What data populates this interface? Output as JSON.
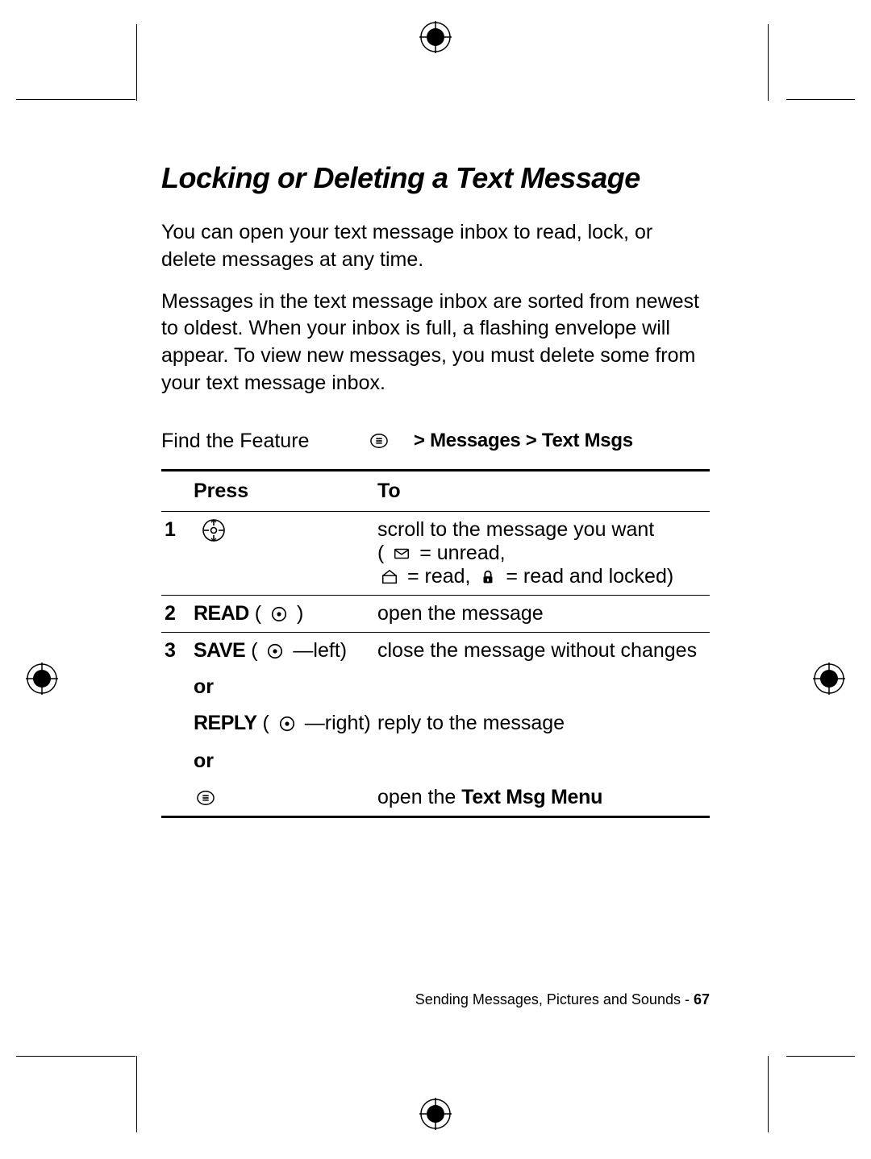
{
  "title": "Locking or Deleting a Text Message",
  "para1": "You can open your text message inbox to read, lock, or delete messages at any time.",
  "para2": "Messages in the text message inbox are sorted from newest to oldest. When your inbox is full, a flashing envelope will appear. To view new messages, you must delete some from your text message inbox.",
  "findFeatureLabel": "Find the Feature",
  "navPath": "> Messages > Text Msgs",
  "headers": {
    "press": "Press",
    "to": "To"
  },
  "steps": {
    "s1": {
      "num": "1",
      "to_pre": "scroll to the message you want",
      "to_leg_open": "(",
      "to_leg_unread": " = unread,",
      "to_leg_read": " = read, ",
      "to_leg_locked": " = read and locked)"
    },
    "s2": {
      "num": "2",
      "pressLabel": "READ",
      "pressSuffix": ")",
      "to": "open the message"
    },
    "s3": {
      "num": "3",
      "press1Label": "SAVE",
      "press1Suffix": "—left)",
      "to1": "close the message without changes",
      "or1": "or",
      "press2Label": "REPLY",
      "press2Suffix": "—right)",
      "to2": "reply to the message",
      "or2": "or",
      "to3_pre": "open the ",
      "to3_bold": "Text Msg Menu"
    }
  },
  "footer": {
    "text": "Sending Messages, Pictures and Sounds - ",
    "page": "67"
  }
}
